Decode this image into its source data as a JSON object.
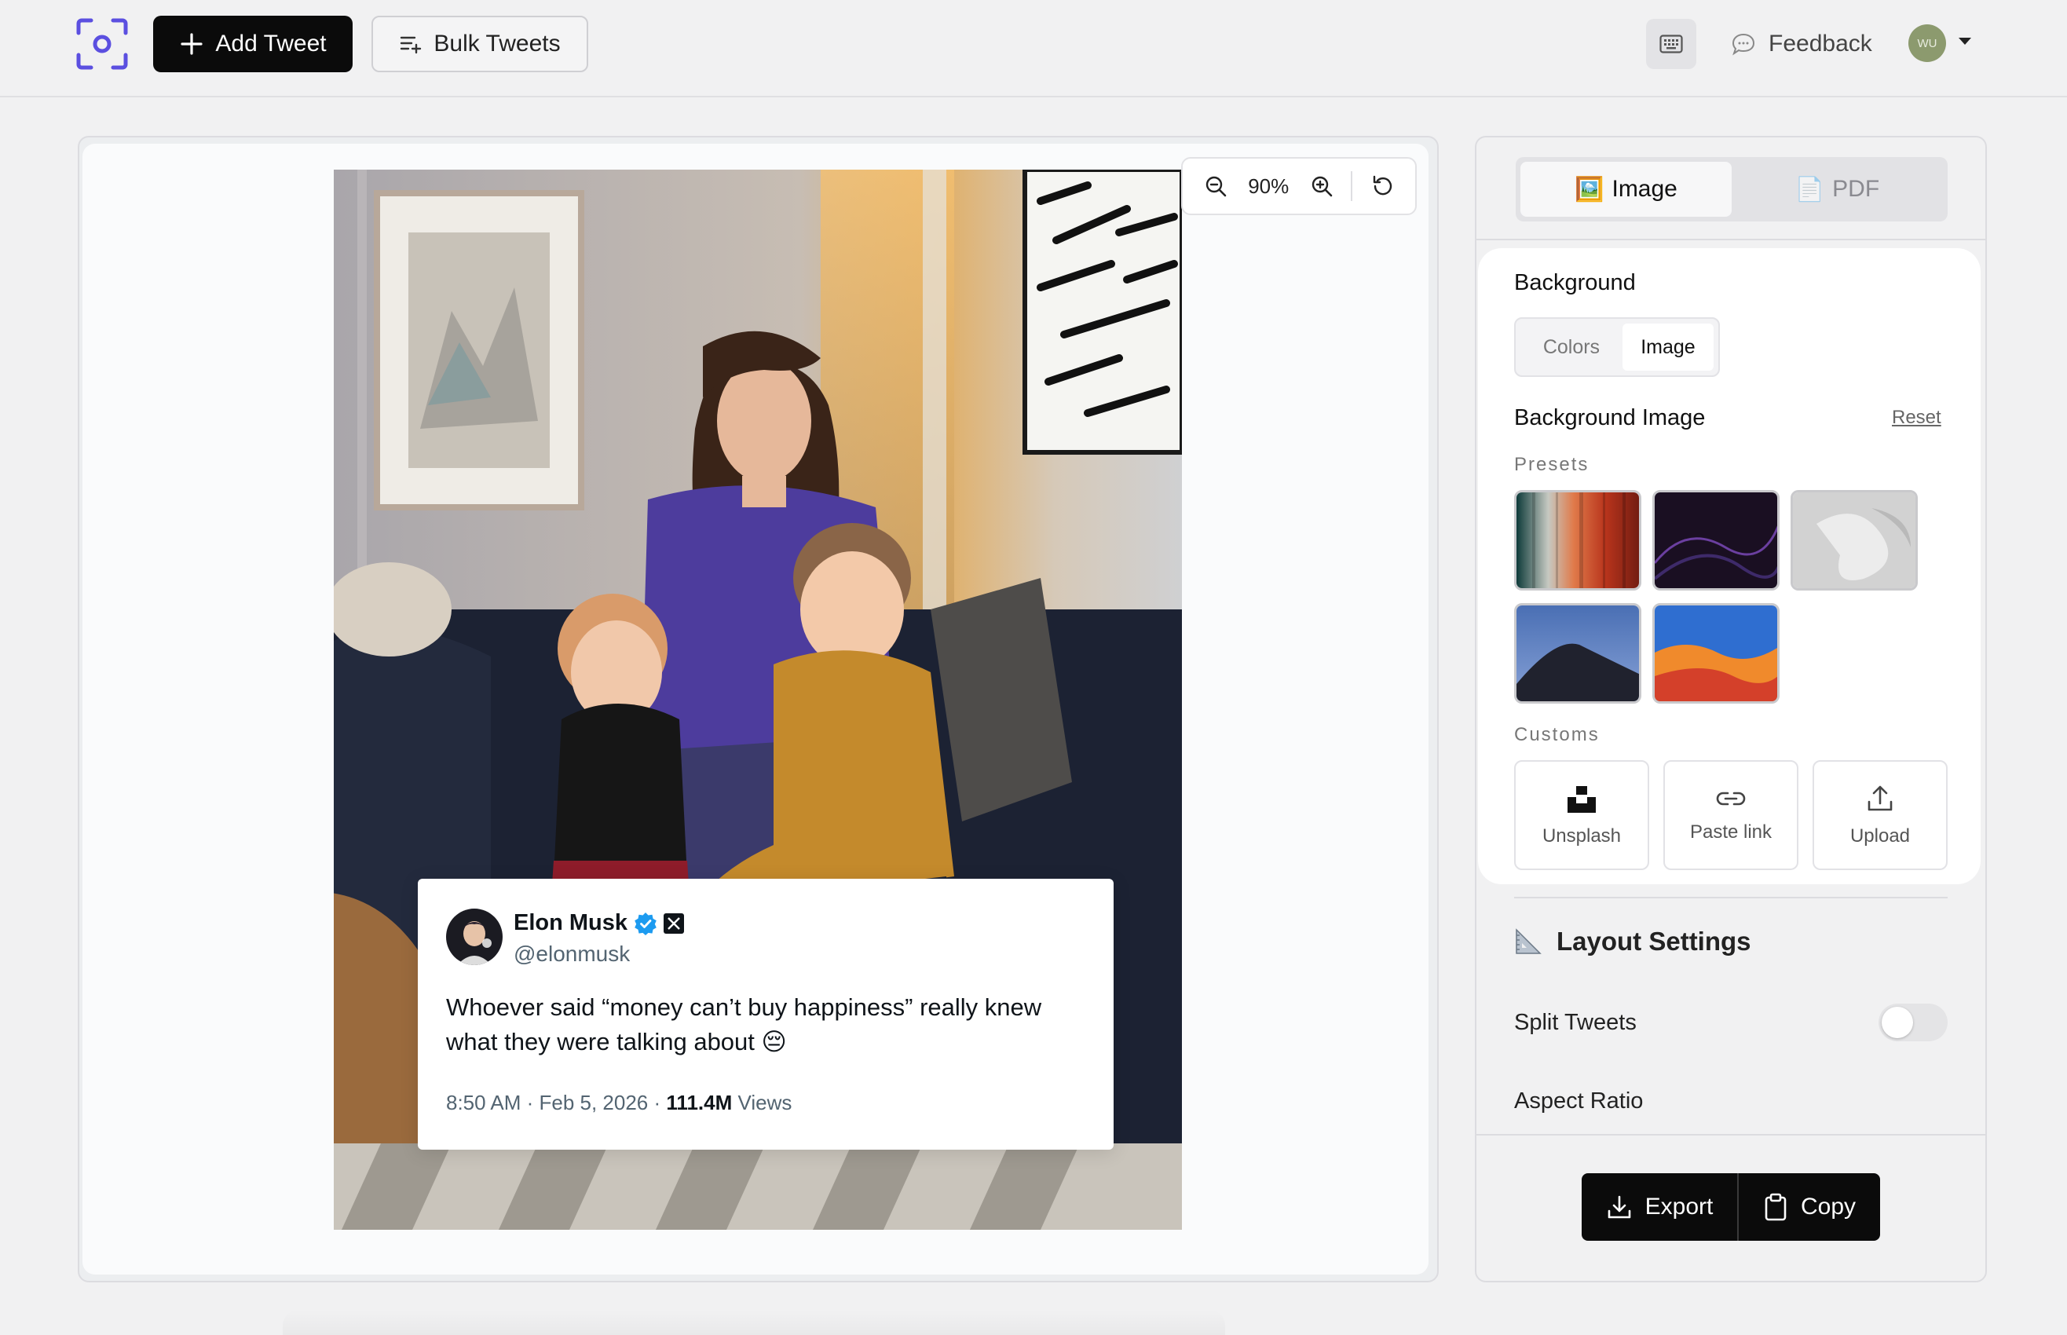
{
  "header": {
    "add_tweet_label": "Add Tweet",
    "bulk_tweets_label": "Bulk Tweets",
    "feedback_label": "Feedback",
    "avatar_initials": "WU",
    "accent_color": "#4f46e5"
  },
  "canvas": {
    "zoom_level": "90%"
  },
  "tweet": {
    "name": "Elon Musk",
    "handle": "@elonmusk",
    "text": "Whoever said “money can’t buy happiness” really knew what they were talking about",
    "emoji": "😔",
    "time_date": "8:50 AM · Feb 5, 2026 · ",
    "views_count": "111.4M",
    "views_label": " Views",
    "verified_color": "#1d9bf0"
  },
  "panel": {
    "tabs": [
      {
        "label": "Image",
        "icon": "🖼️",
        "active": true
      },
      {
        "label": "PDF",
        "icon": "📄",
        "active": false
      }
    ],
    "background_label": "Background",
    "bg_mode_options": [
      {
        "label": "Colors",
        "active": false
      },
      {
        "label": "Image",
        "active": true
      }
    ],
    "background_image_label": "Background Image",
    "reset_label": "Reset",
    "presets_label": "Presets",
    "presets": [
      "striped-gradient",
      "dark-purple-wave",
      "grey-3d-shapes",
      "desert-dune-night",
      "blue-orange-wave"
    ],
    "customs_label": "Customs",
    "customs": [
      {
        "label": "Unsplash",
        "icon": "unsplash-icon"
      },
      {
        "label": "Paste link",
        "icon": "link-icon"
      },
      {
        "label": "Upload",
        "icon": "upload-icon"
      }
    ],
    "layout_settings_label": "Layout Settings",
    "split_tweets_label": "Split Tweets",
    "split_tweets_enabled": false,
    "aspect_ratio_label": "Aspect Ratio",
    "export_label": "Export",
    "copy_label": "Copy"
  }
}
